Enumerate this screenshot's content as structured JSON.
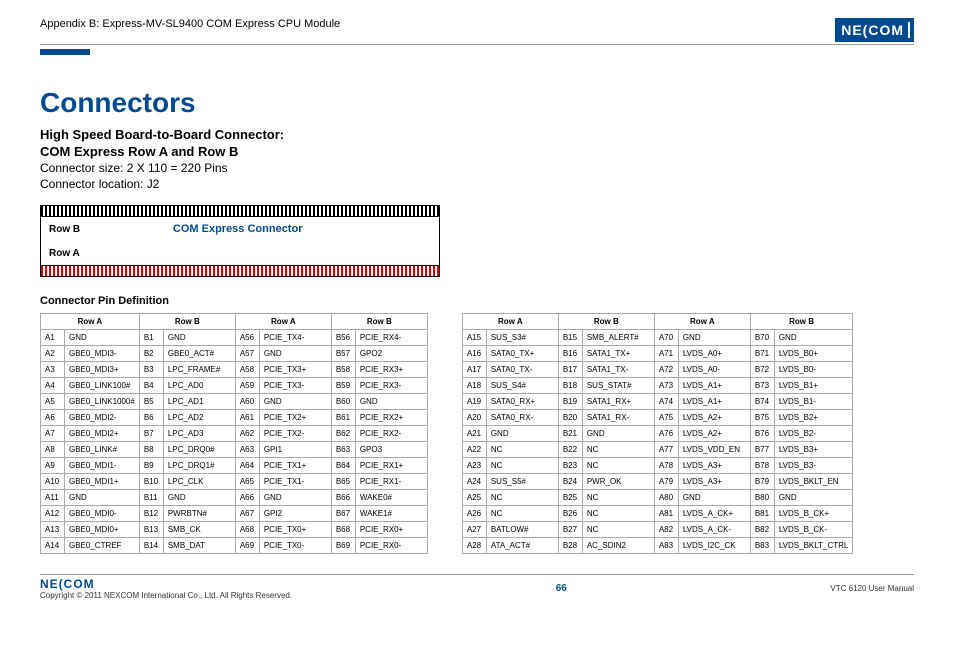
{
  "header": {
    "appendix": "Appendix B: Express-MV-SL9400 COM Express CPU Module",
    "logo_text": "NE(COM"
  },
  "title": "Connectors",
  "subtitle1": "High Speed Board-to-Board Connector:",
  "subtitle2": "COM Express Row A and Row B",
  "conn_size": "Connector size: 2 X 110 = 220 Pins",
  "conn_loc": "Connector location: J2",
  "diagram": {
    "rowb": "Row B",
    "express": "COM Express Connector",
    "rowa": "Row A"
  },
  "pin_def_title": "Connector Pin Definition",
  "row_label_a": "Row A",
  "row_label_b": "Row B",
  "chart_data": {
    "type": "table",
    "title": "Connector Pin Definition",
    "columns": [
      "Row A Pin",
      "Row A Signal",
      "Row B Pin",
      "Row B Signal"
    ],
    "blocks": [
      {
        "rows": [
          [
            "A1",
            "GND",
            "B1",
            "GND"
          ],
          [
            "A2",
            "GBE0_MDI3-",
            "B2",
            "GBE0_ACT#"
          ],
          [
            "A3",
            "GBE0_MDI3+",
            "B3",
            "LPC_FRAME#"
          ],
          [
            "A4",
            "GBE0_LINK100#",
            "B4",
            "LPC_AD0"
          ],
          [
            "A5",
            "GBE0_LINK1000#",
            "B5",
            "LPC_AD1"
          ],
          [
            "A6",
            "GBE0_MDI2-",
            "B6",
            "LPC_AD2"
          ],
          [
            "A7",
            "GBE0_MDI2+",
            "B7",
            "LPC_AD3"
          ],
          [
            "A8",
            "GBE0_LINK#",
            "B8",
            "LPC_DRQ0#"
          ],
          [
            "A9",
            "GBE0_MDI1-",
            "B9",
            "LPC_DRQ1#"
          ],
          [
            "A10",
            "GBE0_MDI1+",
            "B10",
            "LPC_CLK"
          ],
          [
            "A11",
            "GND",
            "B11",
            "GND"
          ],
          [
            "A12",
            "GBE0_MDI0-",
            "B12",
            "PWRBTN#"
          ],
          [
            "A13",
            "GBE0_MDI0+",
            "B13",
            "SMB_CK"
          ],
          [
            "A14",
            "GBE0_CTREF",
            "B14",
            "SMB_DAT"
          ]
        ]
      },
      {
        "rows": [
          [
            "A56",
            "PCIE_TX4-",
            "B56",
            "PCIE_RX4-"
          ],
          [
            "A57",
            "GND",
            "B57",
            "GPO2"
          ],
          [
            "A58",
            "PCIE_TX3+",
            "B58",
            "PCIE_RX3+"
          ],
          [
            "A59",
            "PCIE_TX3-",
            "B59",
            "PCIE_RX3-"
          ],
          [
            "A60",
            "GND",
            "B60",
            "GND"
          ],
          [
            "A61",
            "PCIE_TX2+",
            "B61",
            "PCIE_RX2+"
          ],
          [
            "A62",
            "PCIE_TX2-",
            "B62",
            "PCIE_RX2-"
          ],
          [
            "A63",
            "GPI1",
            "B63",
            "GPO3"
          ],
          [
            "A64",
            "PCIE_TX1+",
            "B64",
            "PCIE_RX1+"
          ],
          [
            "A65",
            "PCIE_TX1-",
            "B65",
            "PCIE_RX1-"
          ],
          [
            "A66",
            "GND",
            "B66",
            "WAKE0#"
          ],
          [
            "A67",
            "GPI2",
            "B67",
            "WAKE1#"
          ],
          [
            "A68",
            "PCIE_TX0+",
            "B68",
            "PCIE_RX0+"
          ],
          [
            "A69",
            "PCIE_TX0-",
            "B69",
            "PCIE_RX0-"
          ]
        ]
      },
      {
        "rows": [
          [
            "A15",
            "SUS_S3#",
            "B15",
            "SMB_ALERT#"
          ],
          [
            "A16",
            "SATA0_TX+",
            "B16",
            "SATA1_TX+"
          ],
          [
            "A17",
            "SATA0_TX-",
            "B17",
            "SATA1_TX-"
          ],
          [
            "A18",
            "SUS_S4#",
            "B18",
            "SUS_STAT#"
          ],
          [
            "A19",
            "SATA0_RX+",
            "B19",
            "SATA1_RX+"
          ],
          [
            "A20",
            "SATA0_RX-",
            "B20",
            "SATA1_RX-"
          ],
          [
            "A21",
            "GND",
            "B21",
            "GND"
          ],
          [
            "A22",
            "NC",
            "B22",
            "NC"
          ],
          [
            "A23",
            "NC",
            "B23",
            "NC"
          ],
          [
            "A24",
            "SUS_S5#",
            "B24",
            "PWR_OK"
          ],
          [
            "A25",
            "NC",
            "B25",
            "NC"
          ],
          [
            "A26",
            "NC",
            "B26",
            "NC"
          ],
          [
            "A27",
            "BATLOW#",
            "B27",
            "NC"
          ],
          [
            "A28",
            "ATA_ACT#",
            "B28",
            "AC_SDIN2"
          ]
        ]
      },
      {
        "rows": [
          [
            "A70",
            "GND",
            "B70",
            "GND"
          ],
          [
            "A71",
            "LVDS_A0+",
            "B71",
            "LVDS_B0+"
          ],
          [
            "A72",
            "LVDS_A0-",
            "B72",
            "LVDS_B0-"
          ],
          [
            "A73",
            "LVDS_A1+",
            "B73",
            "LVDS_B1+"
          ],
          [
            "A74",
            "LVDS_A1+",
            "B74",
            "LVDS_B1-"
          ],
          [
            "A75",
            "LVDS_A2+",
            "B75",
            "LVDS_B2+"
          ],
          [
            "A76",
            "LVDS_A2+",
            "B76",
            "LVDS_B2-"
          ],
          [
            "A77",
            "LVDS_VDD_EN",
            "B77",
            "LVDS_B3+"
          ],
          [
            "A78",
            "LVDS_A3+",
            "B78",
            "LVDS_B3-"
          ],
          [
            "A79",
            "LVDS_A3+",
            "B79",
            "LVDS_BKLT_EN"
          ],
          [
            "A80",
            "GND",
            "B80",
            "GND"
          ],
          [
            "A81",
            "LVDS_A_CK+",
            "B81",
            "LVDS_B_CK+"
          ],
          [
            "A82",
            "LVDS_A_CK-",
            "B82",
            "LVDS_B_CK-"
          ],
          [
            "A83",
            "LVDS_I2C_CK",
            "B83",
            "LVDS_BKLT_CTRL"
          ]
        ]
      }
    ]
  },
  "footer": {
    "logo": "NE(COM",
    "copyright": "Copyright © 2011 NEXCOM International Co., Ltd. All Rights Reserved.",
    "page": "66",
    "manual": "VTC 6120 User Manual"
  }
}
